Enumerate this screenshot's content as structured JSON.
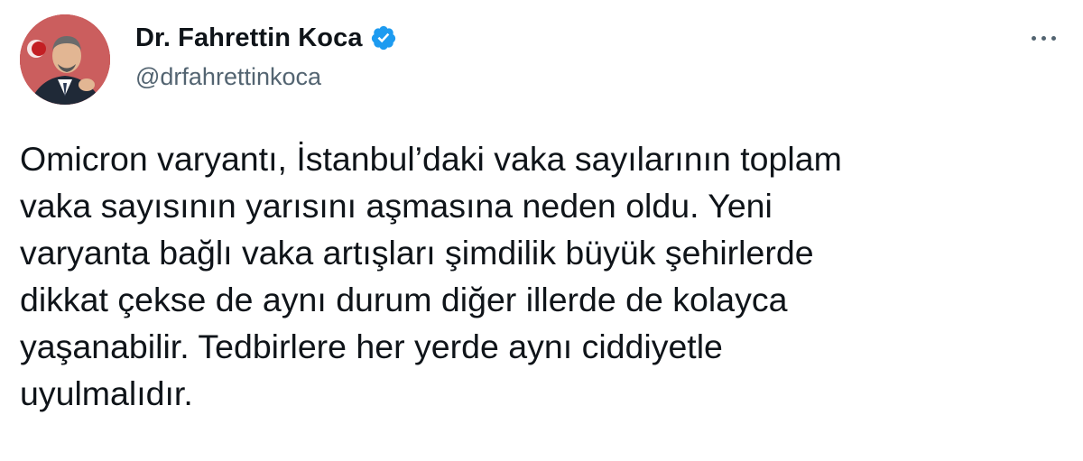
{
  "author": {
    "display_name": "Dr. Fahrettin Koca",
    "handle": "@drfahrettinkoca",
    "verified": true
  },
  "icons": {
    "verified": "verified-badge-icon",
    "more": "more-options-icon"
  },
  "colors": {
    "verified": "#1d9bf0",
    "text": "#0f1419",
    "secondary": "#536471",
    "avatar_background": "#b11a1a"
  },
  "tweet": {
    "lines": [
      "Omicron varyantı, İstanbul’daki vaka sayılarının toplam",
      "vaka sayısının yarısını aşmasına neden oldu. Yeni",
      "varyanta bağlı vaka artışları şimdilik büyük şehirlerde",
      "dikkat çekse de aynı durum diğer illerde de kolayca",
      "yaşanabilir. Tedbirlere her yerde aynı ciddiyetle",
      "uyulmalıdır."
    ]
  }
}
